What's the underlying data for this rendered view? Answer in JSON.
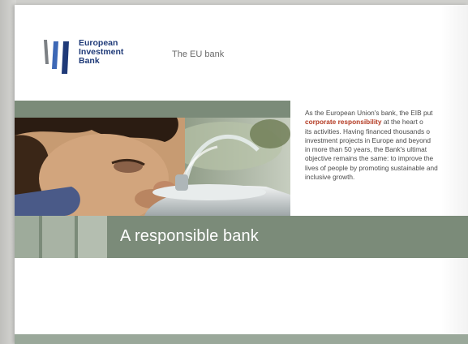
{
  "logo": {
    "line1": "European",
    "line2": "Investment",
    "line3": "Bank",
    "colors": {
      "bar_dark": "#1f3a78",
      "bar_mid": "#3d68b6",
      "bar_grey": "#7c8084"
    }
  },
  "tagline": "The EU bank",
  "hero": {
    "photo_icon": "child-drinking-fountain-photo",
    "title": "A responsible bank",
    "colors": {
      "band": "#7b8b79",
      "stripe_light": "#a8b3a4",
      "stripe_mid": "#929f8f"
    }
  },
  "body": {
    "lines": [
      [
        "As the European Union's bank, the EIB put",
        ""
      ],
      [
        "",
        "corporate responsibility",
        " at the heart o"
      ],
      [
        "its activities. Having financed thousands o"
      ],
      [
        "investment projects in Europe and beyond"
      ],
      [
        "in more than 50 years, the Bank's ultimat"
      ],
      [
        "objective remains the same: to improve the"
      ],
      [
        "lives of people by promoting sustainable and"
      ],
      [
        "inclusive growth."
      ]
    ],
    "highlight_color": "#b33a22"
  }
}
